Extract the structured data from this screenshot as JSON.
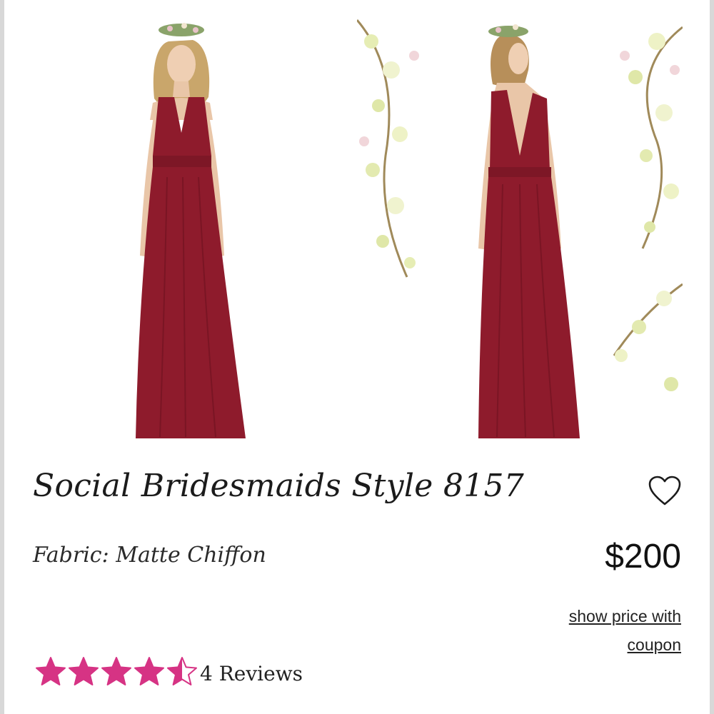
{
  "product": {
    "title": "Social Bridesmaids Style 8157",
    "fabric": "Fabric: Matte Chiffon",
    "price": "$200",
    "coupon_link": "show price with coupon",
    "rating": 4.5,
    "rating_max": 5,
    "reviews": "4 Reviews",
    "favorite_icon": "heart-outline-icon",
    "star_icon": "star-icon"
  },
  "gallery": {
    "images": [
      {
        "view": "front",
        "dress_color": "#8e1b2c"
      },
      {
        "view": "back",
        "dress_color": "#8e1b2c"
      }
    ]
  },
  "colors": {
    "star": "#d63384",
    "text": "#1b1b1b",
    "dress": "#8e1b2c"
  }
}
